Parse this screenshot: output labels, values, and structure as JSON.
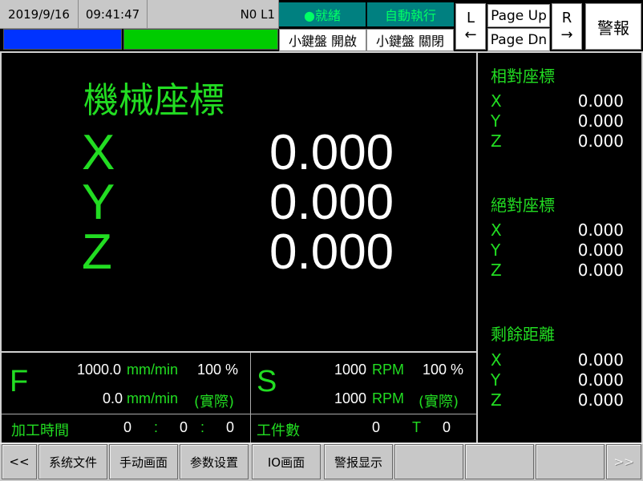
{
  "header": {
    "date": "2019/9/16",
    "time": "09:41:47",
    "program": "N0 L1",
    "status_ready": "●就緒",
    "status_auto": "自動執行",
    "kbd_open": "小鍵盤 開啟",
    "kbd_close": "小鍵盤 關閉",
    "key_l": "L",
    "arrow_left": "←",
    "page_up": "Page Up",
    "page_dn": "Page Dn",
    "key_r": "R",
    "arrow_right": "→",
    "alarm": "警報"
  },
  "main": {
    "title": "機械座標",
    "axes": [
      {
        "label": "X",
        "value": "0.000"
      },
      {
        "label": "Y",
        "value": "0.000"
      },
      {
        "label": "Z",
        "value": "0.000"
      }
    ]
  },
  "feed": {
    "label": "F",
    "set_value": "1000.0",
    "set_unit": "mm/min",
    "set_pct": "100 %",
    "act_value": "0.0",
    "act_unit": "mm/min",
    "act_note": "(實際)"
  },
  "spindle": {
    "label": "S",
    "set_value": "1000",
    "set_unit": "RPM",
    "set_pct": "100 %",
    "act_value": "1000",
    "act_unit": "RPM",
    "act_note": "(實際)"
  },
  "bottom": {
    "time_label": "加工時間",
    "h": "0",
    "sep1": ":",
    "m": "0",
    "sep2": ":",
    "s": "0",
    "count_label": "工件數",
    "count": "0",
    "tool_label": "T",
    "tool": "0"
  },
  "right_panel": {
    "relative_title": "相對座標",
    "relative": [
      {
        "a": "X",
        "v": "0.000"
      },
      {
        "a": "Y",
        "v": "0.000"
      },
      {
        "a": "Z",
        "v": "0.000"
      }
    ],
    "absolute_title": "絕對座標",
    "absolute": [
      {
        "a": "X",
        "v": "0.000"
      },
      {
        "a": "Y",
        "v": "0.000"
      },
      {
        "a": "Z",
        "v": "0.000"
      }
    ],
    "remaining_title": "剩餘距離",
    "remaining": [
      {
        "a": "X",
        "v": "0.000"
      },
      {
        "a": "Y",
        "v": "0.000"
      },
      {
        "a": "Z",
        "v": "0.000"
      }
    ]
  },
  "softkeys": {
    "prev": "<<",
    "k1": "系统文件",
    "k2": "手动画面",
    "k3": "参数设置",
    "k4": "IO画面",
    "k5": "警报显示",
    "next": ">>"
  },
  "colors": {
    "accent_green": "#22dd22",
    "status_teal": "#008080",
    "progress_blue": "#0033ff",
    "progress_green": "#00cc00"
  }
}
